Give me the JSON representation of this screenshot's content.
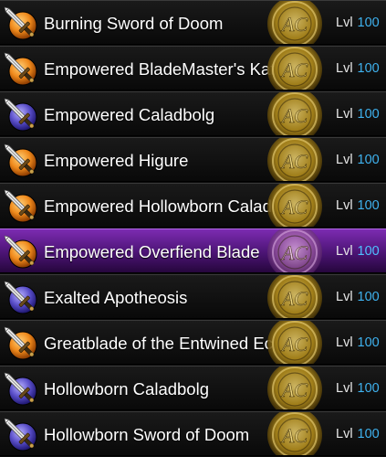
{
  "items": [
    {
      "name": "Burning Sword of Doom",
      "level_label": "Lvl",
      "level": "100",
      "icon": "orange-sword-icon",
      "selected": false
    },
    {
      "name": "Empowered BladeMaster's Katana",
      "level_label": "Lvl",
      "level": "100",
      "icon": "orange-sword-icon",
      "selected": false
    },
    {
      "name": "Empowered Caladbolg",
      "level_label": "Lvl",
      "level": "100",
      "icon": "purple-sword-icon",
      "selected": false
    },
    {
      "name": "Empowered Higure",
      "level_label": "Lvl",
      "level": "100",
      "icon": "orange-sword-icon",
      "selected": false
    },
    {
      "name": "Empowered Hollowborn Caladbolg",
      "level_label": "Lvl",
      "level": "100",
      "icon": "orange-sword-icon",
      "selected": false
    },
    {
      "name": "Empowered Overfiend Blade",
      "level_label": "Lvl",
      "level": "100",
      "icon": "orange-sword-icon",
      "selected": true
    },
    {
      "name": "Exalted Apotheosis",
      "level_label": "Lvl",
      "level": "100",
      "icon": "purple-sword-icon",
      "selected": false
    },
    {
      "name": "Greatblade of the Entwined Eclipse",
      "level_label": "Lvl",
      "level": "100",
      "icon": "orange-sword-icon",
      "selected": false
    },
    {
      "name": "Hollowborn Caladbolg",
      "level_label": "Lvl",
      "level": "100",
      "icon": "purple-sword-icon",
      "selected": false
    },
    {
      "name": "Hollowborn Sword of Doom",
      "level_label": "Lvl",
      "level": "100",
      "icon": "purple-sword-icon",
      "selected": false
    }
  ],
  "badge_text": "AC",
  "colors": {
    "row_bg": "#111111",
    "selected_bg": "#5a1b88",
    "level_value": "#3fb2ef",
    "orange_orb": "#f08a1c",
    "purple_orb": "#5a4fc9",
    "medal_gold": "#b08a1a"
  }
}
